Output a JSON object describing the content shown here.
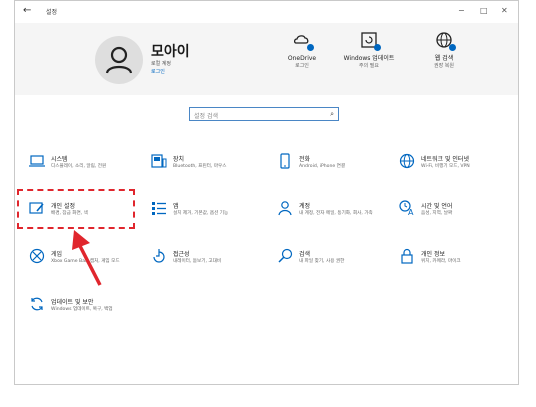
{
  "window": {
    "title": "설정",
    "back": "←",
    "minimize": "−",
    "maximize": "□",
    "close": "✕"
  },
  "user": {
    "name": "모아이",
    "account": "로컬 계정",
    "login": "로그인"
  },
  "header_items": [
    {
      "icon": "onedrive-icon",
      "title": "OneDrive",
      "sub": "로그인"
    },
    {
      "icon": "windows-update-icon",
      "title": "Windows 업데이트",
      "sub": "주의 필요"
    },
    {
      "icon": "web-search-icon",
      "title": "웹 검색",
      "sub": "권장 복원"
    }
  ],
  "search": {
    "placeholder": "설정 검색",
    "icon": "search-icon"
  },
  "categories": [
    {
      "icon": "laptop-icon",
      "title": "시스템",
      "desc": "디스플레이, 소리, 알림, 전원"
    },
    {
      "icon": "devices-icon",
      "title": "장치",
      "desc": "Bluetooth, 프린터, 마우스"
    },
    {
      "icon": "phone-icon",
      "title": "전화",
      "desc": "Android, iPhone 연결"
    },
    {
      "icon": "globe-icon",
      "title": "네트워크 및 인터넷",
      "desc": "Wi-Fi, 비행기 모드, VPN"
    },
    {
      "icon": "personalization-icon",
      "title": "개인 설정",
      "desc": "배경, 잠금 화면, 색"
    },
    {
      "icon": "apps-icon",
      "title": "앱",
      "desc": "설치 제거, 기본값, 옵션 기능"
    },
    {
      "icon": "accounts-icon",
      "title": "계정",
      "desc": "내 계정, 전자 메일, 동기화, 회사, 가족"
    },
    {
      "icon": "time-language-icon",
      "title": "시간 및 언어",
      "desc": "음성, 지역, 날짜"
    },
    {
      "icon": "xbox-icon",
      "title": "게임",
      "desc": "Xbox Game Bar, 캡처, 게임 모드"
    },
    {
      "icon": "accessibility-icon",
      "title": "접근성",
      "desc": "내레이터, 돋보기, 고대비"
    },
    {
      "icon": "search-category-icon",
      "title": "검색",
      "desc": "내 파일 찾기, 사용 권한"
    },
    {
      "icon": "lock-icon",
      "title": "개인 정보",
      "desc": "위치, 카메라, 마이크"
    },
    {
      "icon": "update-icon",
      "title": "업데이트 및 보안",
      "desc": "Windows 업데이트, 복구, 백업"
    }
  ],
  "colors": {
    "accent": "#0067c0",
    "annotation": "#e0262d",
    "header_bg": "#f5f5f5"
  }
}
